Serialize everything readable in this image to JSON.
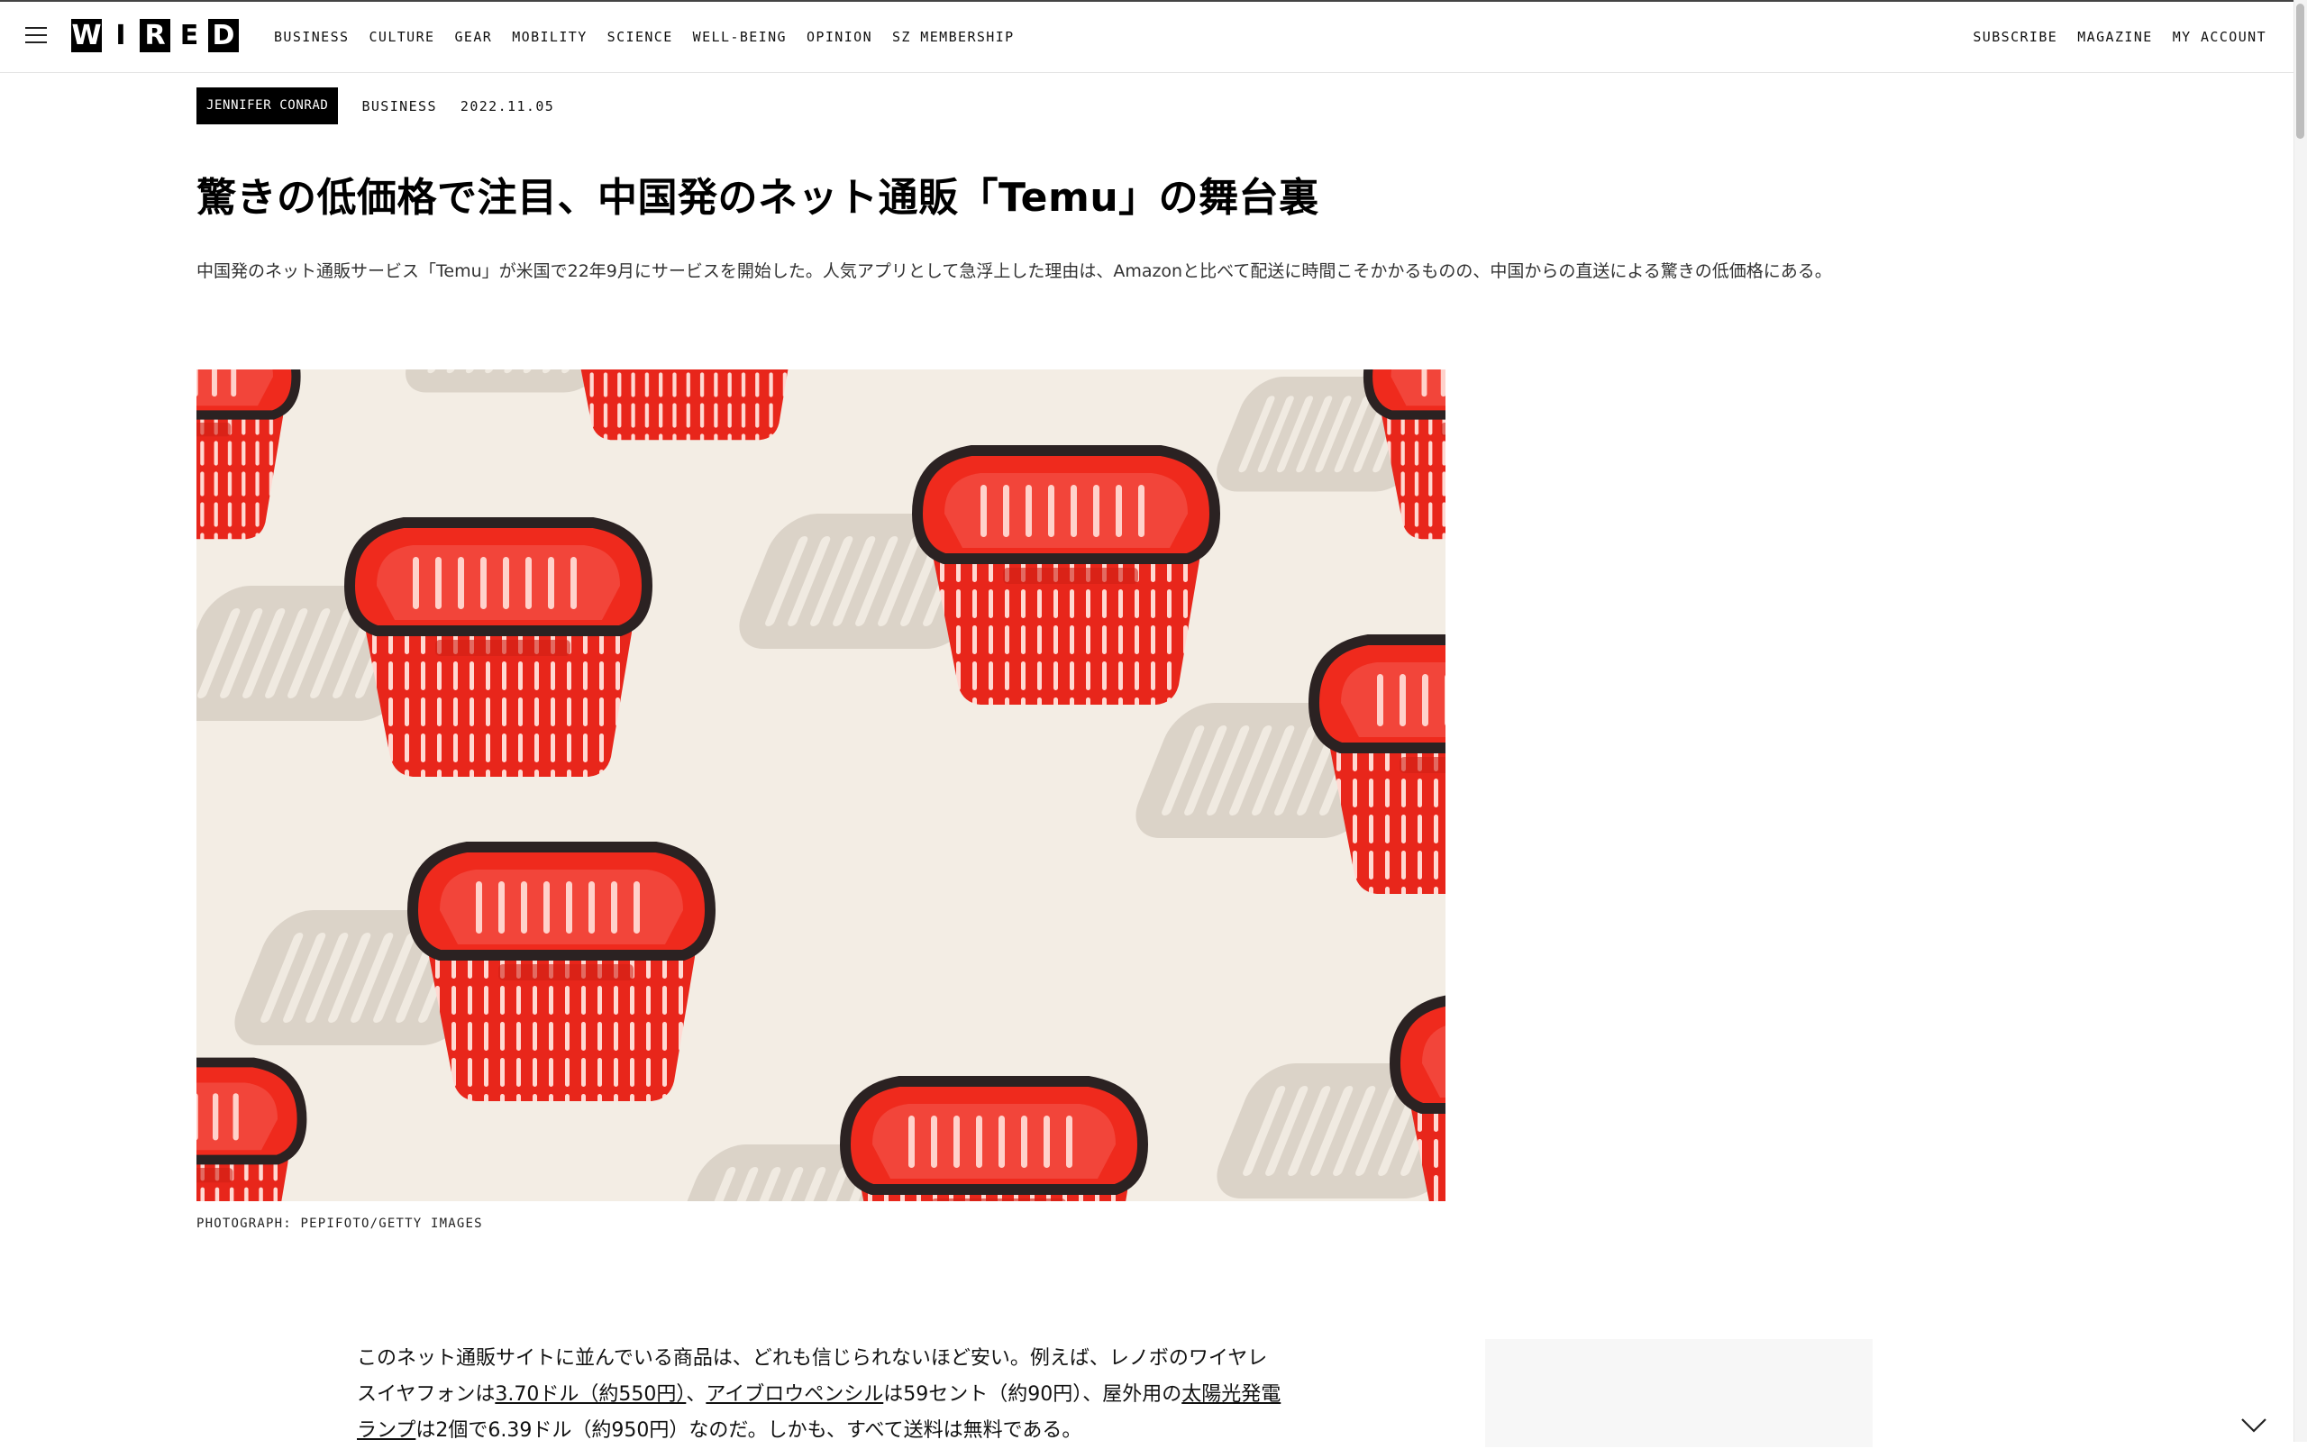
{
  "nav": {
    "logo_letters": [
      "W",
      "I",
      "R",
      "E",
      "D"
    ],
    "left_items": [
      "BUSINESS",
      "CULTURE",
      "GEAR",
      "MOBILITY",
      "SCIENCE",
      "WELL-BEING",
      "OPINION",
      "SZ MEMBERSHIP"
    ],
    "right_items": [
      "SUBSCRIBE",
      "MAGAZINE",
      "MY ACCOUNT"
    ],
    "menu_icon": "hamburger-menu-icon"
  },
  "article": {
    "author": "JENNIFER CONRAD",
    "category": "BUSINESS",
    "date": "2022.11.05",
    "headline": "驚きの低価格で注目、中国発のネット通販「Temu」の舞台裏",
    "dek": "中国発のネット通販サービス「Temu」が米国で22年9月にサービスを開始した。人気アプリとして急浮上した理由は、Amazonと比べて配送に時間こそかかるものの、中国からの直送による驚きの低価格にある。",
    "image_credit": "PHOTOGRAPH: PEPIFOTO/GETTY IMAGES",
    "body": {
      "p1_a": "このネット通販サイトに並んでいる商品は、どれも信じられないほど安い。例えば、レノボのワイヤレスイヤフォンは",
      "link1": "3.70ドル（約550円）",
      "p1_b": "、",
      "link2": "アイブロウペンシル",
      "p1_c": "は59セント（約90円）、屋外用の",
      "link3": "太陽光発電ランプ",
      "p1_d": "は2個で6.39ドル（約950円）なのだ。しかも、すべて送料は無料である。"
    }
  },
  "colors": {
    "accent": "#000000",
    "basket_red": "#ef2a1d",
    "image_bg": "#f3ede4"
  },
  "icons": {
    "scroll_down": "chevron-down-icon"
  }
}
